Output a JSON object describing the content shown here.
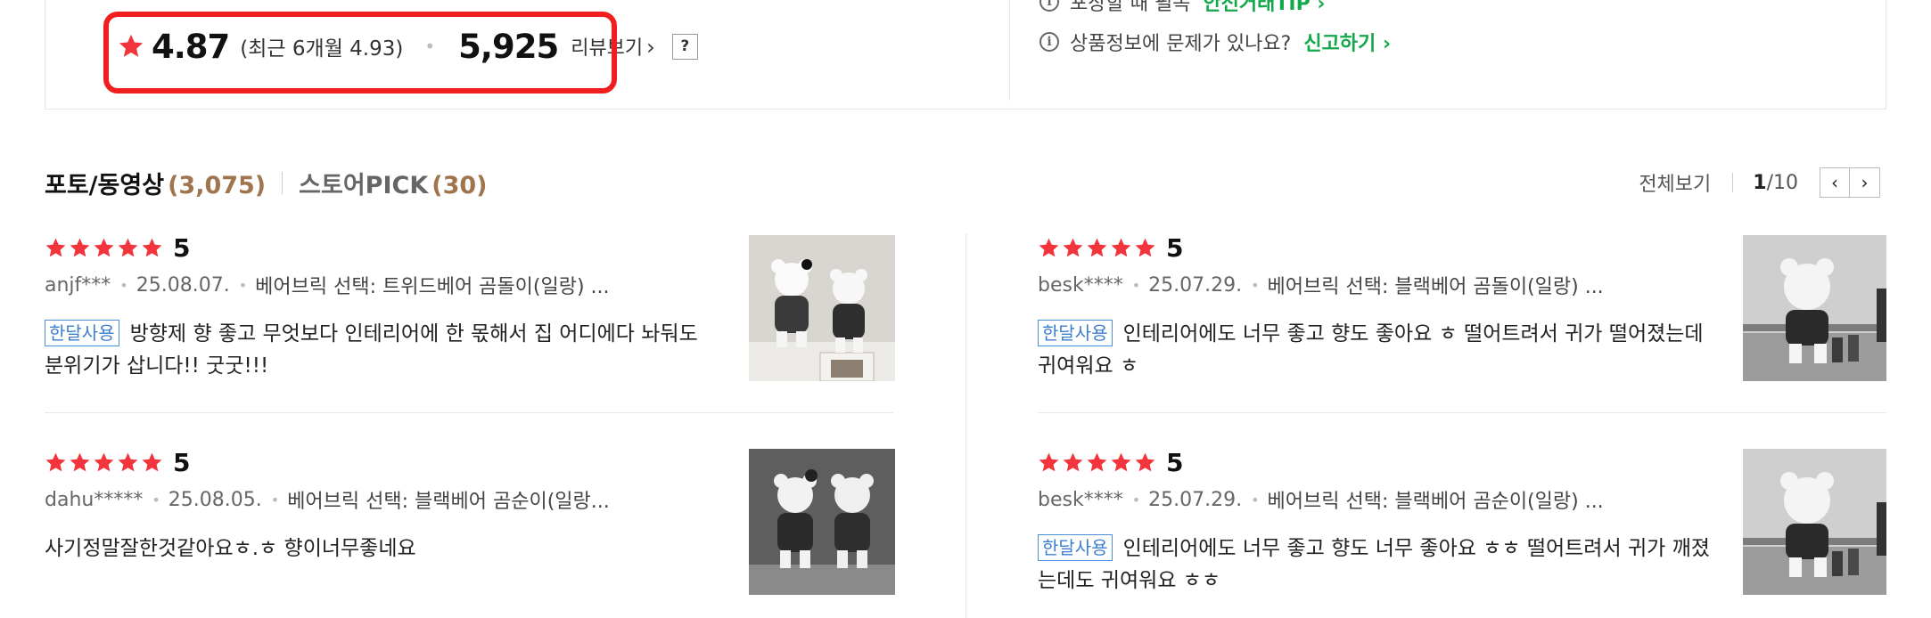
{
  "summary": {
    "rating": "4.87",
    "recent": "(최근 6개월 4.93)",
    "review_count": "5,925",
    "review_link": "리뷰보기",
    "help": "?",
    "info_line1_text": "포장할 때 필독",
    "info_line1_link": "안전거래TIP",
    "info_line2_text": "상품정보에 문제가 있나요?",
    "info_line2_link": "신고하기",
    "highlight_color": "#f01e1e",
    "accent_green": "#13a84a"
  },
  "tabs": [
    {
      "label": "포토/동영상",
      "count": "(3,075)"
    },
    {
      "label": "스토어PICK",
      "count": "(30)"
    }
  ],
  "pager": {
    "all_label": "전체보기",
    "current": "1",
    "total": "/10"
  },
  "reviews": [
    {
      "score": "5",
      "user": "anjf***",
      "date": "25.08.07.",
      "option": "베어브릭 선택: 트위드베어 곰돌이(일랑) ...",
      "badge": "한달사용",
      "text": "방향제 향 좋고 무엇보다 인테리어에 한 몫해서 집 어디에다 놔둬도 분위기가 삽니다!! 굿굿!!!"
    },
    {
      "score": "5",
      "user": "besk****",
      "date": "25.07.29.",
      "option": "베어브릭 선택: 블랙베어 곰돌이(일랑) ...",
      "badge": "한달사용",
      "text": "인테리어에도 너무 좋고 향도 좋아요 ㅎ 떨어트려서 귀가 떨어졌는데 귀여워요 ㅎ"
    },
    {
      "score": "5",
      "user": "dahu*****",
      "date": "25.08.05.",
      "option": "베어브릭 선택: 블랙베어 곰순이(일랑...",
      "badge": "",
      "text": "사기정말잘한것같아요ㅎ.ㅎ 향이너무좋네요"
    },
    {
      "score": "5",
      "user": "besk****",
      "date": "25.07.29.",
      "option": "베어브릭 선택: 블랙베어 곰순이(일랑) ...",
      "badge": "한달사용",
      "text": "인테리어에도 너무 좋고 향도 너무 좋아요 ㅎㅎ 떨어트려서 귀가 깨졌는데도 귀여워요 ㅎㅎ"
    }
  ],
  "colors": {
    "star": "#f2353c",
    "count_brown": "#a0754d",
    "badge_blue": "#3b7fcf"
  },
  "icons": [
    "star-icon",
    "info-icon",
    "chevron-right-icon",
    "chevron-left-icon",
    "help-icon"
  ]
}
